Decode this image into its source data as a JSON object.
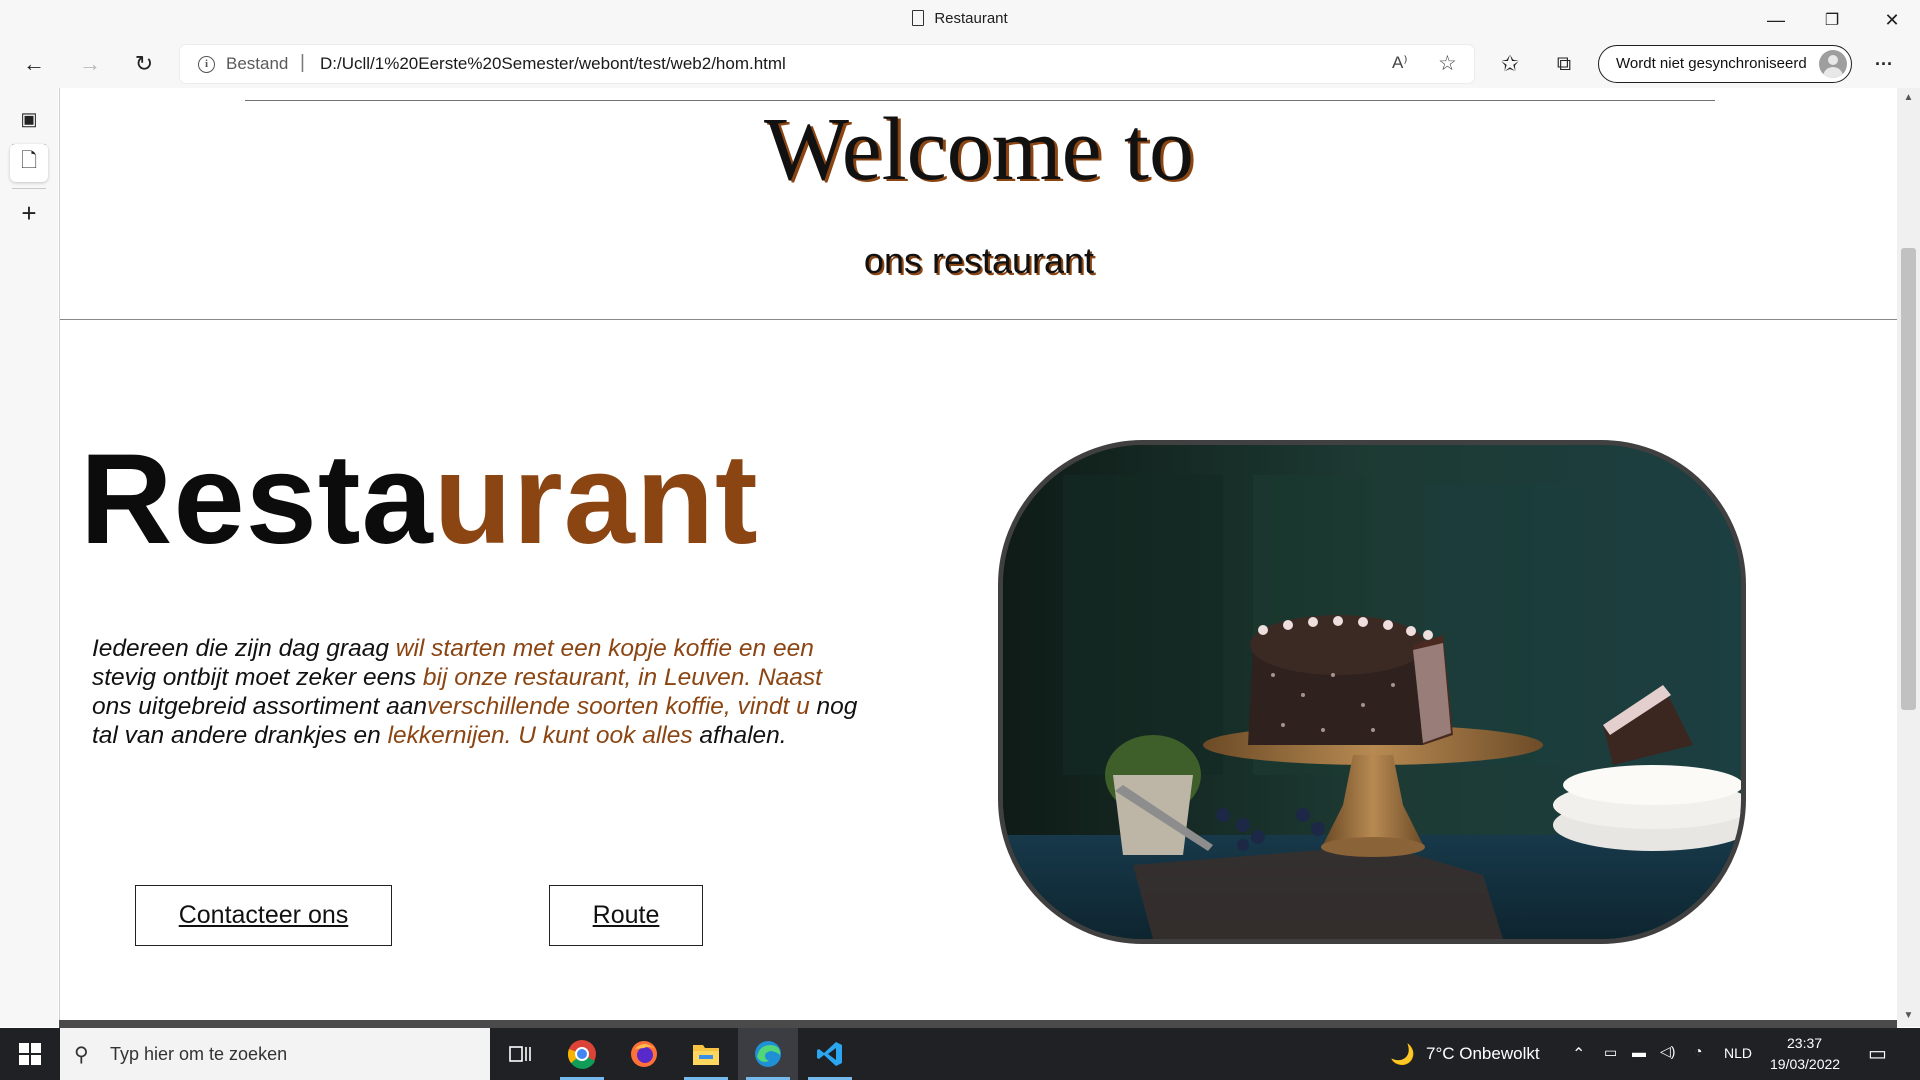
{
  "window": {
    "title": "Restaurant",
    "minimize": "—",
    "maximize": "❐",
    "close": "✕"
  },
  "toolbar": {
    "back": "←",
    "forward": "→",
    "refresh": "↻",
    "info_label": "i",
    "protocol_label": "Bestand",
    "separator": "|",
    "url": "D:/Ucll/1%20Eerste%20Semester/webont/test/web2/hom.html",
    "read_aloud": "A⁾",
    "favorites_add": "☆",
    "favorites": "✩",
    "collections": "⧉",
    "profile_label": "Wordt niet gesynchroniseerd",
    "more": "···"
  },
  "sidebar": {
    "tab_actions": "▣",
    "current_tab": "🗋",
    "new_tab": "+"
  },
  "page": {
    "welcome": "Welcome to",
    "subtitle": "ons restaurant",
    "title_part1": "Resta",
    "title_part2": "urant",
    "intro": [
      {
        "text": "Iedereen die zijn dag graag ",
        "accent": false
      },
      {
        "text": "wil starten met een kopje koffie en een",
        "accent": true
      },
      {
        "text": " stevig ontbijt moet zeker eens ",
        "accent": false
      },
      {
        "text": "bij onze restaurant, in Leuven. Naast",
        "accent": true
      },
      {
        "text": " ons uitgebreid assortiment aan",
        "accent": false
      },
      {
        "text": "verschillende soorten koffie, vindt u",
        "accent": true
      },
      {
        "text": " nog tal van andere drankjes en ",
        "accent": false
      },
      {
        "text": "lekkernijen. U kunt ook alles",
        "accent": true
      },
      {
        "text": " afhalen.",
        "accent": false
      }
    ],
    "contact_button": "Contacteer ons",
    "route_button": "Route",
    "accent_color": "#8b4513"
  },
  "taskbar": {
    "search_placeholder": "Typ hier om te zoeken",
    "weather_icon": "🌙",
    "weather": "7°C  Onbewolkt",
    "language": "NLD",
    "time": "23:37",
    "date": "19/03/2022",
    "apps": [
      "task-view-icon",
      "chrome-icon",
      "firefox-icon",
      "file-explorer-icon",
      "edge-icon",
      "vscode-icon"
    ]
  }
}
